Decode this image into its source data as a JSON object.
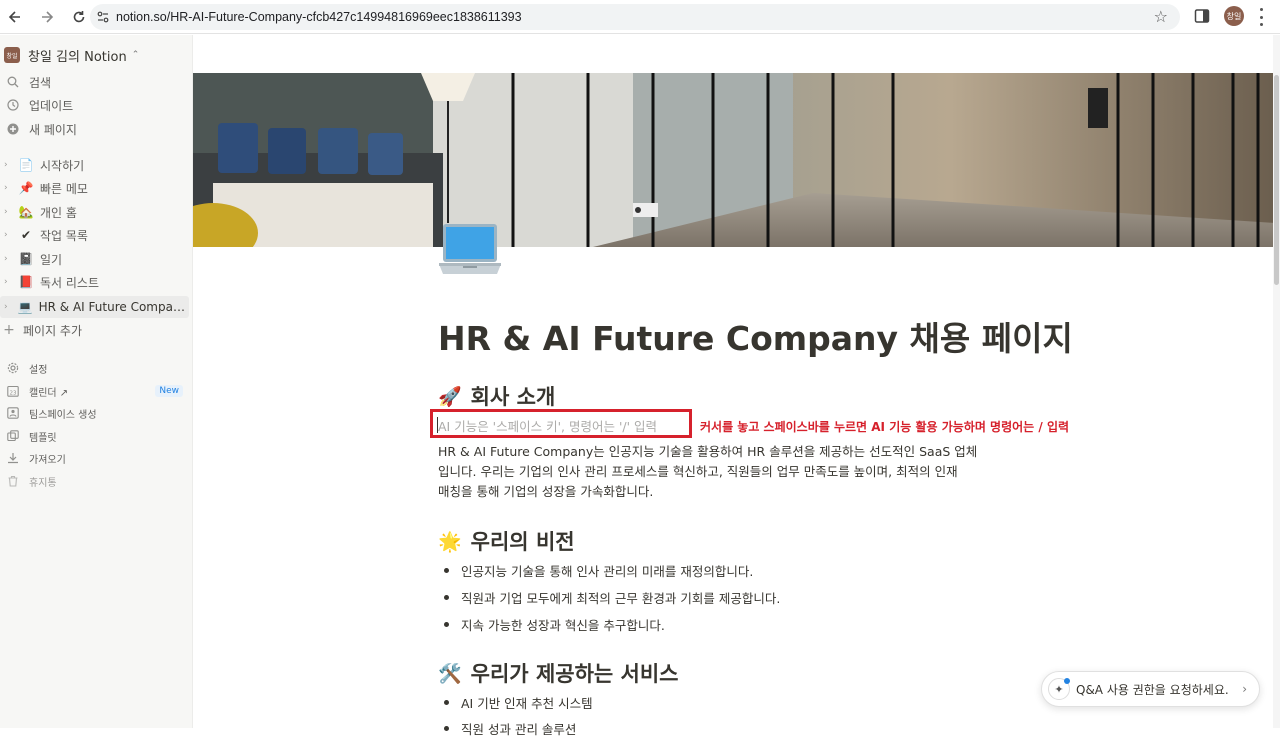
{
  "browser": {
    "url": "notion.so/HR-AI-Future-Company-cfcb427c14994816969eec1838611393",
    "profile_initials": "창일"
  },
  "sidebar": {
    "workspace_avatar": "창일",
    "workspace_name": "창일 김의 Notion",
    "top_items": [
      {
        "label": "검색",
        "icon": "search-icon"
      },
      {
        "label": "업데이트",
        "icon": "clock-icon"
      },
      {
        "label": "새 페이지",
        "icon": "plus-circle-icon"
      }
    ],
    "pages": [
      {
        "emoji": "📄",
        "label": "시작하기"
      },
      {
        "emoji": "📌",
        "label": "빠른 메모"
      },
      {
        "emoji": "🏡",
        "label": "개인 홈"
      },
      {
        "emoji": "✔",
        "label": "작업 목록"
      },
      {
        "emoji": "📓",
        "label": "일기"
      },
      {
        "emoji": "📕",
        "label": "독서 리스트"
      },
      {
        "emoji": "💻",
        "label": "HR & AI Future Company..."
      }
    ],
    "add_page_label": "페이지 추가",
    "bottom_items": [
      {
        "label": "설정",
        "icon": "gear-icon"
      },
      {
        "label": "캘린더 ↗",
        "icon": "calendar-icon",
        "badge": "New"
      },
      {
        "label": "팀스페이스 생성",
        "icon": "team-icon"
      },
      {
        "label": "템플릿",
        "icon": "template-icon"
      },
      {
        "label": "가져오기",
        "icon": "download-icon"
      },
      {
        "label": "휴지통",
        "icon": "trash-icon"
      }
    ]
  },
  "page": {
    "icon": "laptop-icon",
    "title": "HR & AI Future Company 채용 페이지",
    "section1": {
      "emoji": "🚀",
      "heading": "회사 소개"
    },
    "placeholder": "AI 기능은 '스페이스 키', 명령어는 '/' 입력",
    "annotation": "커서를 놓고 스페이스바를 누르면 AI 기능 활용 가능하며 명령어는 / 입력",
    "intro_lines": [
      "HR & AI Future Company는 인공지능 기술을 활용하여 HR 솔루션을 제공하는 선도적인 SaaS 업체",
      "입니다. 우리는 기업의 인사 관리 프로세스를 혁신하고, 직원들의 업무 만족도를 높이며, 최적의 인재",
      "매칭을 통해 기업의 성장을 가속화합니다."
    ],
    "section2": {
      "emoji": "🌟",
      "heading": "우리의 비전"
    },
    "vision": [
      "인공지능 기술을 통해 인사 관리의 미래를 재정의합니다.",
      "직원과 기업 모두에게 최적의 근무 환경과 기회를 제공합니다.",
      "지속 가능한 성장과 혁신을 추구합니다."
    ],
    "section3": {
      "emoji": "🛠️",
      "heading": "우리가 제공하는 서비스"
    },
    "services": [
      "AI 기반 인재 추천 시스템",
      "직원 성과 관리 솔루션"
    ]
  },
  "qa": {
    "text": "Q&A 사용 권한을 요청하세요."
  },
  "colors": {
    "annotation_red": "#d6212c",
    "sidebar_bg": "#f7f7f5",
    "text": "#37352f"
  }
}
